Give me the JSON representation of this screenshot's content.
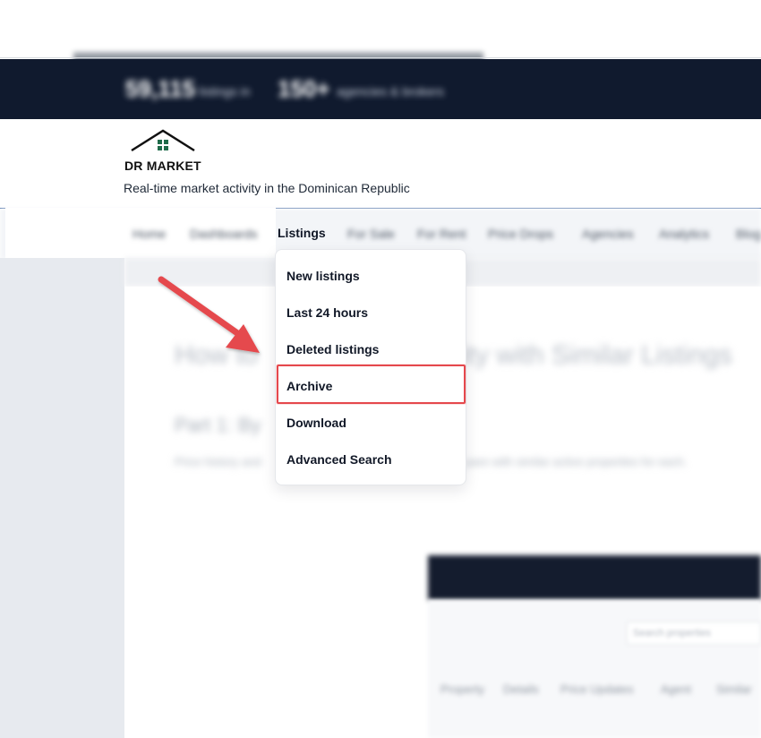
{
  "brand": {
    "name": "DR MARKET",
    "tagline": "Real-time market activity in the Dominican Republic",
    "logo_icon": "house-roof-icon",
    "logo_color": "#1f6b4a"
  },
  "topbar": {
    "stat_primary_value": "59,115",
    "stat_primary_label": "listings in",
    "stat_secondary_value": "150+",
    "stat_secondary_label": "agencies & brokers"
  },
  "nav": {
    "items": [
      {
        "label": "Home"
      },
      {
        "label": "Dashboards"
      },
      {
        "label": "Listings",
        "active": true
      },
      {
        "label": "For Sale"
      },
      {
        "label": "For Rent"
      },
      {
        "label": "Price Drops"
      },
      {
        "label": "Agencies"
      },
      {
        "label": "Analytics"
      },
      {
        "label": "Blog"
      }
    ]
  },
  "dropdown": {
    "items": [
      {
        "label": "New listings"
      },
      {
        "label": "Last 24 hours"
      },
      {
        "label": "Deleted listings"
      },
      {
        "label": "Archive",
        "highlighted": true
      },
      {
        "label": "Download"
      },
      {
        "label": "Advanced Search"
      }
    ]
  },
  "background_page": {
    "title_left": "How to",
    "title_right": "ity with Similar Listings",
    "subtitle": "Part 1: By",
    "paragraph_left": "Price history and",
    "paragraph_right": "pare with similar active properties for each.",
    "screenshot_tabs": [
      "Property",
      "Details",
      "Price Updates",
      "Agent",
      "Similar"
    ],
    "screenshot_field_placeholder": "Search properties"
  },
  "colors": {
    "topbar": "#101a2e",
    "accent_highlight": "#e5484d",
    "arrow": "#e5484d",
    "header_rule": "#4b6fa8"
  }
}
